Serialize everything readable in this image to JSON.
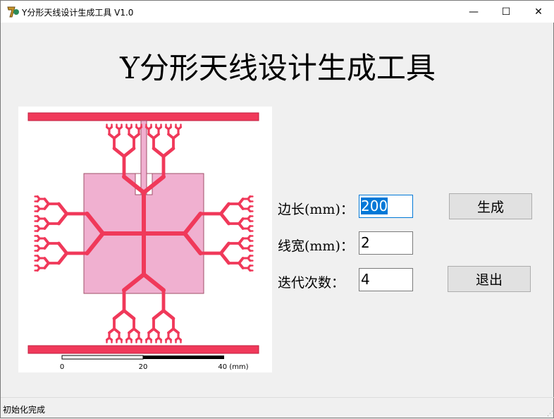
{
  "window": {
    "title": "Y分形天线设计生成工具 V1.0",
    "minimize": "—",
    "maximize": "☐",
    "close": "✕"
  },
  "heading": "Y分形天线设计生成工具",
  "scale_bar": {
    "labels": [
      "0",
      "20",
      "40 (mm)"
    ]
  },
  "form": {
    "side_length": {
      "label": "边长(mm)：",
      "value": "200"
    },
    "line_width": {
      "label": "线宽(mm)：",
      "value": "2"
    },
    "iterations": {
      "label": "迭代次数：",
      "value": "4"
    }
  },
  "buttons": {
    "generate": "生成",
    "exit": "退出"
  },
  "status": "初始化完成",
  "colors": {
    "trace": "#f0395a",
    "patch": "#f0b0d0"
  }
}
